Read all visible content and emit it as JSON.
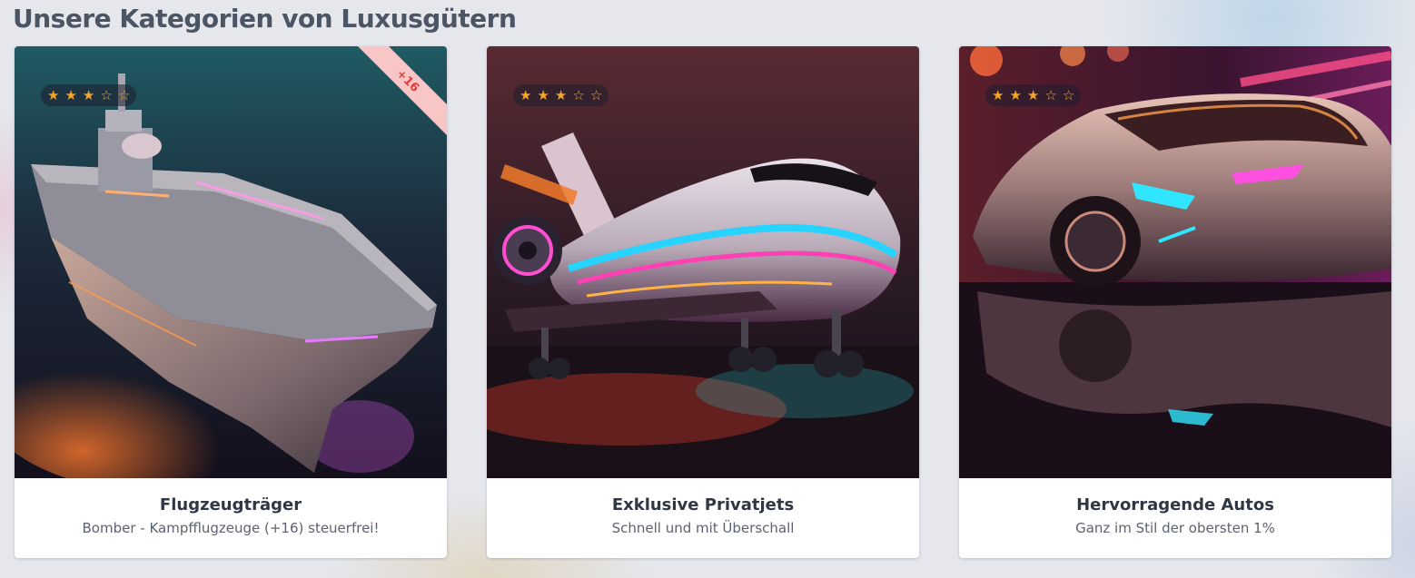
{
  "page": {
    "title": "Unsere Kategorien von Luxusgütern"
  },
  "colors": {
    "star": "#f5a623",
    "ribbon_bg": "#f9c6c6",
    "ribbon_text": "#e23b3b",
    "title": "#4b5563"
  },
  "cards": [
    {
      "title": "Flugzeugträger",
      "subtitle": "Bomber - Kampfflugzeuge (+16) steuerfrei!",
      "rating": 3,
      "rating_max": 5,
      "badge": "+16",
      "image_icon": "aircraft-carrier-image"
    },
    {
      "title": "Exklusive Privatjets",
      "subtitle": "Schnell und mit Überschall",
      "rating": 3,
      "rating_max": 5,
      "image_icon": "private-jet-image"
    },
    {
      "title": "Hervorragende Autos",
      "subtitle": "Ganz im Stil der obersten 1%",
      "rating": 3,
      "rating_max": 5,
      "image_icon": "sports-car-image"
    }
  ]
}
